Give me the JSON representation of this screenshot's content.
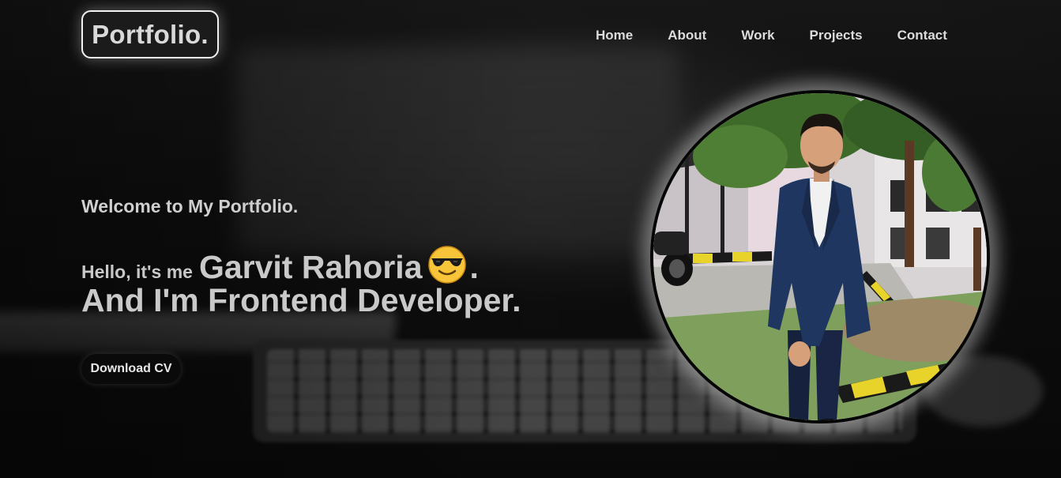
{
  "header": {
    "logo": "Portfolio.",
    "nav": [
      {
        "label": "Home"
      },
      {
        "label": "About"
      },
      {
        "label": "Work"
      },
      {
        "label": "Projects"
      },
      {
        "label": "Contact"
      }
    ]
  },
  "hero": {
    "welcome": "Welcome to My Portfolio.",
    "hello_prefix": "Hello, it's me",
    "name": "Garvit Rahoria",
    "emoji_icon": "sunglasses-face-icon",
    "name_suffix": ".",
    "role": "And I'm Frontend Developer.",
    "cta_label": "Download CV"
  },
  "colors": {
    "text": "#cfcfcf",
    "logo_border": "#f2f2f2",
    "button_bg": "#0a0a0a",
    "background": "#0c0c0c"
  }
}
